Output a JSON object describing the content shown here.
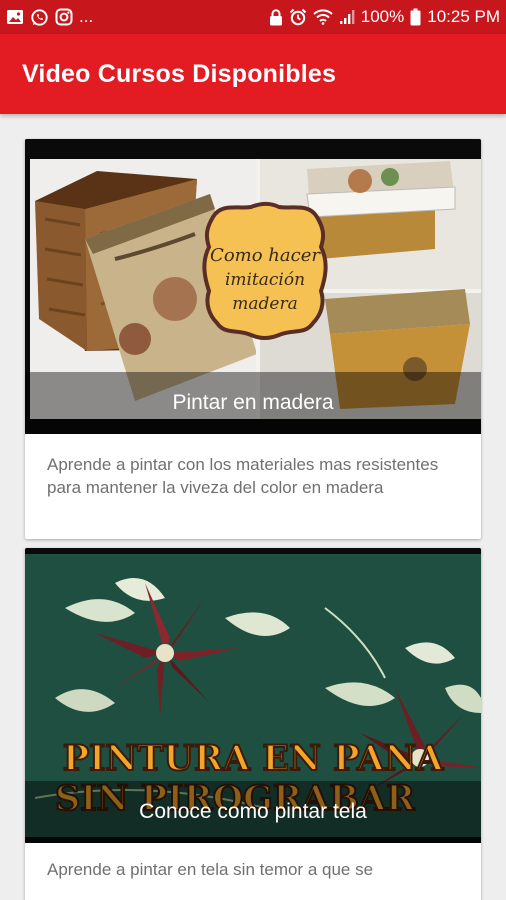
{
  "status_bar": {
    "left_icons": [
      "image-icon",
      "whatsapp-icon",
      "instagram-icon"
    ],
    "more": "...",
    "battery_percent": "100%",
    "time": "10:25 PM"
  },
  "app_bar": {
    "title": "Video Cursos Disponibles",
    "color": "#e31b23"
  },
  "courses": [
    {
      "thumbnail_text": "Como hacer imitación madera",
      "caption": "Pintar en madera",
      "description": "Aprende a pintar con los materiales mas resistentes para mantener la viveza del color en madera"
    },
    {
      "thumbnail_title_line1": "PINTURA EN PANA",
      "thumbnail_title_line2": "SIN PIROGRABAR",
      "caption": "Conoce como pintar tela",
      "description": "Aprende a pintar en tela sin temor a que se"
    }
  ]
}
